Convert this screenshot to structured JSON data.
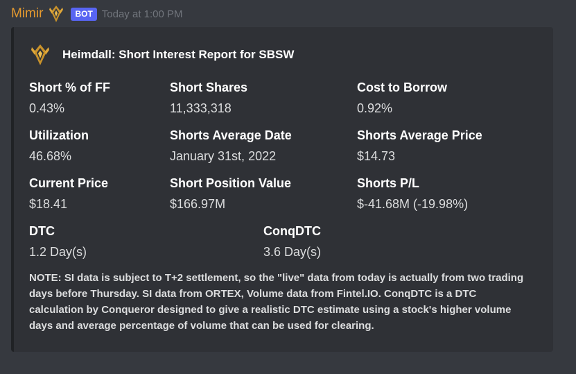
{
  "message": {
    "username": "Mimir",
    "bot_tag": "BOT",
    "timestamp": "Today at 1:00 PM",
    "username_color": "#e59a2f",
    "bot_tag_color": "#5865f2"
  },
  "embed": {
    "author": "Heimdall: Short Interest Report for SBSW",
    "fields": [
      {
        "name": "Short % of FF",
        "value": "0.43%"
      },
      {
        "name": "Short Shares",
        "value": "11,333,318"
      },
      {
        "name": "Cost to Borrow",
        "value": "0.92%"
      },
      {
        "name": "Utilization",
        "value": "46.68%"
      },
      {
        "name": "Shorts Average Date",
        "value": "January 31st, 2022"
      },
      {
        "name": "Shorts Average Price",
        "value": "$14.73"
      },
      {
        "name": "Current Price",
        "value": "$18.41"
      },
      {
        "name": "Short Position Value",
        "value": "$166.97M"
      },
      {
        "name": "Shorts P/L",
        "value": "$-41.68M (-19.98%)"
      },
      {
        "name": "DTC",
        "value": "1.2 Day(s)"
      },
      {
        "name": "ConqDTC",
        "value": "3.6 Day(s)"
      }
    ],
    "note": "NOTE: SI data is subject to T+2 settlement, so the \"live\" data from today is actually from two trading days before Thursday. SI data from ORTEX, Volume data from Fintel.IO. ConqDTC is a DTC calculation by Conqueror designed to give a realistic DTC estimate using a stock's higher volume days and average percentage of volume that can be used for clearing."
  },
  "icons": {
    "user_icon": "gold-emblem-icon",
    "author_icon": "gold-emblem-icon"
  }
}
